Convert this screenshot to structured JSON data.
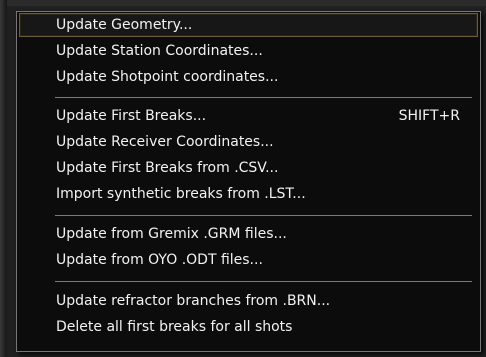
{
  "menu": {
    "items": [
      {
        "label": "Update Geometry...",
        "shortcut": "",
        "highlighted": true
      },
      {
        "label": "Update Station Coordinates...",
        "shortcut": "",
        "highlighted": false
      },
      {
        "label": "Update Shotpoint coordinates...",
        "shortcut": "",
        "highlighted": false
      },
      {
        "label": "Update First Breaks...",
        "shortcut": "SHIFT+R",
        "highlighted": false
      },
      {
        "label": "Update Receiver Coordinates...",
        "shortcut": "",
        "highlighted": false
      },
      {
        "label": "Update First Breaks from .CSV...",
        "shortcut": "",
        "highlighted": false
      },
      {
        "label": "Import synthetic breaks from .LST...",
        "shortcut": "",
        "highlighted": false
      },
      {
        "label": "Update from Gremix .GRM files...",
        "shortcut": "",
        "highlighted": false
      },
      {
        "label": "Update from OYO .ODT files...",
        "shortcut": "",
        "highlighted": false
      },
      {
        "label": "Update refractor branches from .BRN...",
        "shortcut": "",
        "highlighted": false
      },
      {
        "label": "Delete all first breaks for all shots",
        "shortcut": "",
        "highlighted": false
      }
    ]
  },
  "colors": {
    "menu_background": "#0c0c0c",
    "menu_text": "#f2f2f2",
    "menu_border": "#777777",
    "separator": "#7a7a7a",
    "highlight_border": "#6d5b32"
  }
}
